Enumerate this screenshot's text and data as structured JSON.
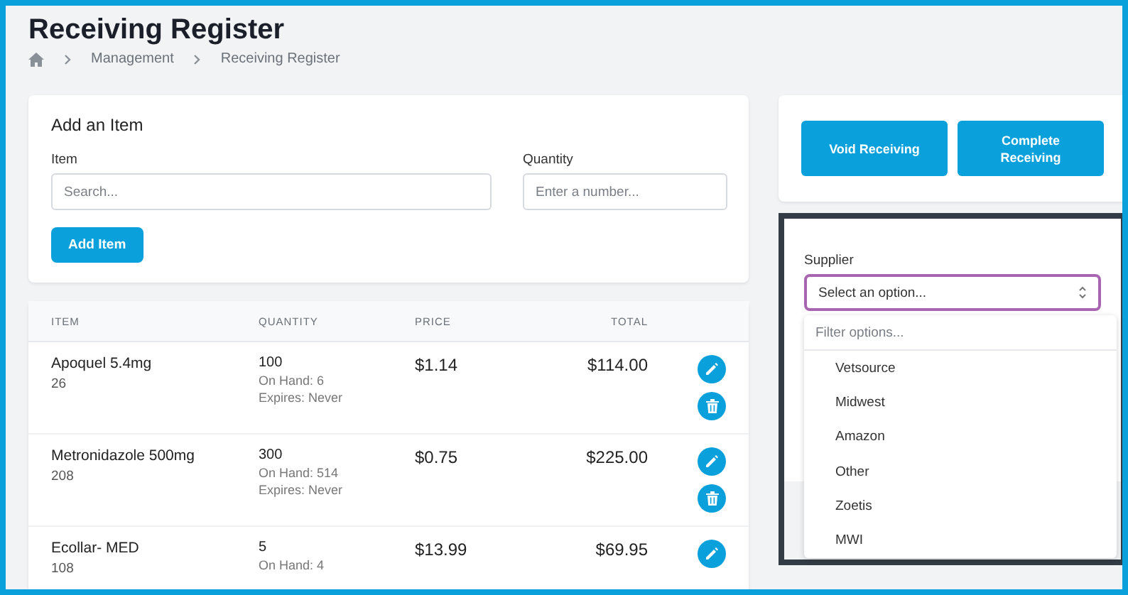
{
  "page": {
    "title": "Receiving Register",
    "breadcrumb": [
      "Management",
      "Receiving Register"
    ]
  },
  "add_item": {
    "heading": "Add an Item",
    "item_label": "Item",
    "item_placeholder": "Search...",
    "quantity_label": "Quantity",
    "quantity_placeholder": "Enter a number...",
    "button": "Add Item"
  },
  "table": {
    "columns": [
      "ITEM",
      "QUANTITY",
      "PRICE",
      "TOTAL"
    ],
    "rows": [
      {
        "item": "Apoquel 5.4mg",
        "code": "26",
        "quantity": "100",
        "on_hand": "On Hand: 6",
        "expires": "Expires: Never",
        "price": "$1.14",
        "total": "$114.00",
        "actions": [
          {
            "kind": "edit"
          },
          {
            "kind": "delete"
          }
        ]
      },
      {
        "item": "Metronidazole 500mg",
        "code": "208",
        "quantity": "300",
        "on_hand": "On Hand: 514",
        "expires": "Expires: Never",
        "price": "$0.75",
        "total": "$225.00",
        "actions": [
          {
            "kind": "edit"
          },
          {
            "kind": "delete"
          }
        ]
      },
      {
        "item": "Ecollar- MED",
        "code": "108",
        "quantity": "5",
        "on_hand": "On Hand: 4",
        "price": "$13.99",
        "total": "$69.95",
        "actions": [
          {
            "kind": "edit"
          }
        ]
      }
    ]
  },
  "actions": [
    "Void Receiving",
    "Complete Receiving"
  ],
  "supplier": {
    "label": "Supplier",
    "placeholder": "Select an option...",
    "expanded": true,
    "filter_placeholder": "Filter options...",
    "options": [
      "Vetsource",
      "Midwest",
      "Amazon",
      "Other",
      "Zoetis",
      "MWI"
    ]
  }
}
